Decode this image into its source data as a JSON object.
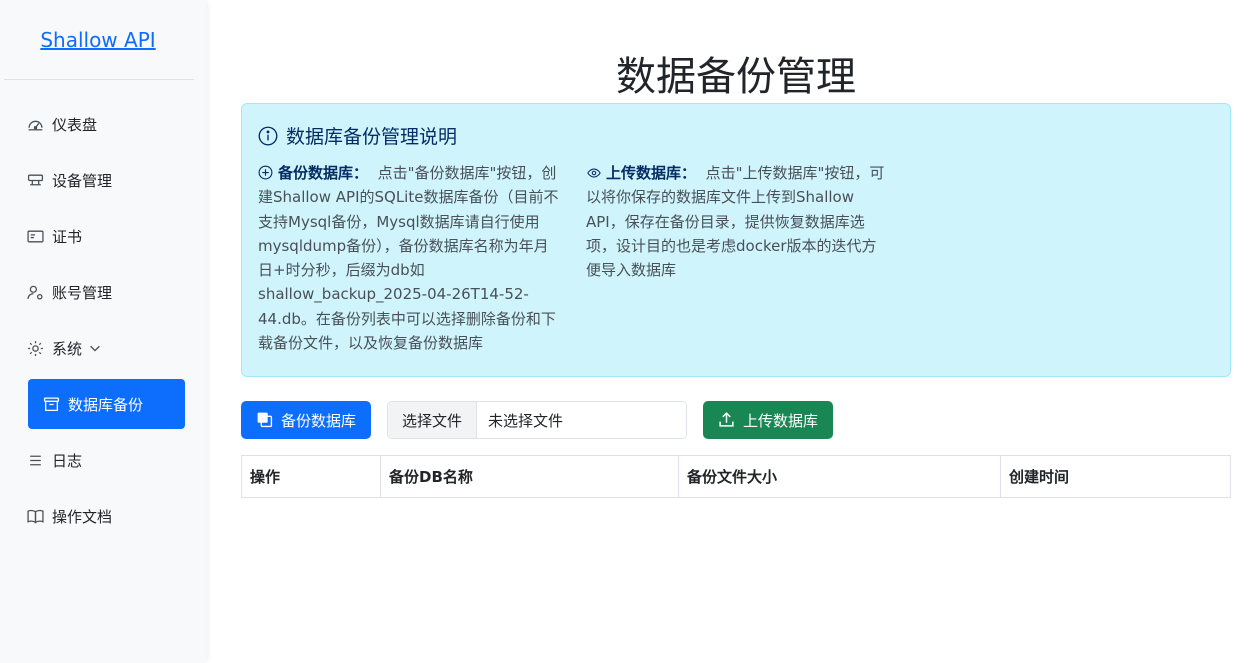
{
  "sidebar": {
    "brand": "Shallow API",
    "items": [
      {
        "label": "仪表盘",
        "icon": "speedometer-icon"
      },
      {
        "label": "设备管理",
        "icon": "device-icon"
      },
      {
        "label": "证书",
        "icon": "card-icon"
      },
      {
        "label": "账号管理",
        "icon": "user-gear-icon"
      },
      {
        "label": "系统",
        "icon": "gear-icon"
      },
      {
        "label": "数据库备份",
        "icon": "archive-icon",
        "active": true
      },
      {
        "label": "日志",
        "icon": "list-icon"
      },
      {
        "label": "操作文档",
        "icon": "book-icon"
      }
    ]
  },
  "page": {
    "title": "数据备份管理"
  },
  "alert": {
    "heading": "数据库备份管理说明",
    "backup_title": "备份数据库：",
    "backup_text": "点击\"备份数据库\"按钮，创建Shallow API的SQLite数据库备份（目前不支持Mysql备份，Mysql数据库请自行使用mysqldump备份），备份数据库名称为年月日+时分秒，后缀为db如shallow_backup_2025-04-26T14-52-44.db。在备份列表中可以选择删除备份和下载备份文件，以及恢复备份数据库",
    "upload_title": "上传数据库：",
    "upload_text": "点击\"上传数据库\"按钮，可以将你保存的数据库文件上传到Shallow API，保存在备份目录，提供恢复数据库选项，设计目的也是考虑docker版本的迭代方便导入数据库"
  },
  "actions": {
    "backup_button": "备份数据库",
    "choose_file_button": "选择文件",
    "no_file_text": "未选择文件",
    "upload_button": "上传数据库"
  },
  "table": {
    "headers": [
      "操作",
      "备份DB名称",
      "备份文件大小",
      "创建时间"
    ]
  },
  "colors": {
    "primary": "#0d6efd",
    "success": "#198754",
    "info_bg": "#cff4fc",
    "info_border": "#9eeaf9"
  }
}
